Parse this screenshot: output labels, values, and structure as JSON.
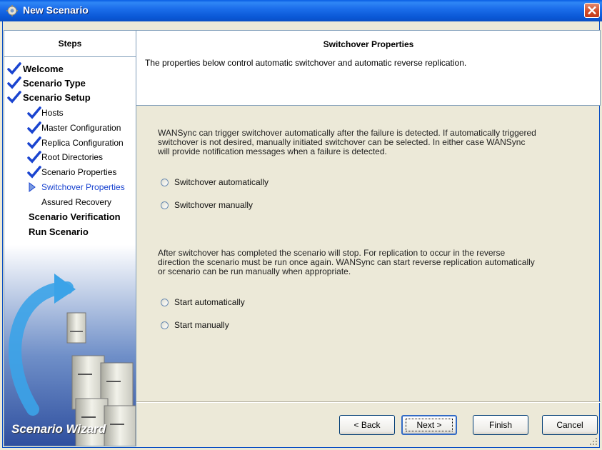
{
  "window": {
    "title": "New Scenario",
    "icon": "scenario-gear-icon",
    "close_icon": "close-icon"
  },
  "steps": {
    "header": "Steps",
    "items": [
      {
        "label": "Welcome",
        "level": 0,
        "state": "done"
      },
      {
        "label": "Scenario Type",
        "level": 0,
        "state": "done"
      },
      {
        "label": "Scenario Setup",
        "level": 0,
        "state": "done"
      },
      {
        "label": "Hosts",
        "level": 1,
        "state": "done"
      },
      {
        "label": "Master Configuration",
        "level": 1,
        "state": "done"
      },
      {
        "label": "Replica Configuration",
        "level": 1,
        "state": "done"
      },
      {
        "label": "Root Directories",
        "level": 1,
        "state": "done"
      },
      {
        "label": "Scenario Properties",
        "level": 1,
        "state": "done"
      },
      {
        "label": "Switchover Properties",
        "level": 1,
        "state": "current"
      },
      {
        "label": "Assured Recovery",
        "level": 1,
        "state": "pending"
      },
      {
        "label": "Scenario Verification",
        "level": 0,
        "state": "pending"
      },
      {
        "label": "Run Scenario",
        "level": 0,
        "state": "pending"
      }
    ],
    "wizard_label": "Scenario Wizard"
  },
  "header": {
    "title": "Switchover Properties",
    "description": "The properties below control automatic switchover and automatic reverse replication."
  },
  "switchover": {
    "text": "WANSync can trigger switchover automatically after the failure is detected. If automatically triggered switchover is not desired, manually initiated switchover can be selected. In either case WANSync will provide notification messages when a failure is detected.",
    "options": [
      "Switchover automatically",
      "Switchover manually"
    ]
  },
  "reverse": {
    "text": "After switchover has completed the scenario will stop. For replication to occur in the reverse direction the scenario must be run once again. WANSync can start reverse replication automatically or scenario can be run manually when appropriate.",
    "options": [
      "Start automatically",
      "Start manually"
    ]
  },
  "buttons": {
    "back": "< Back",
    "next": "Next >",
    "finish": "Finish",
    "cancel": "Cancel"
  },
  "colors": {
    "titlebar": "#0A5FE4",
    "window_bg": "#ECE9D8",
    "check": "#1A44D0",
    "current_step": "#1A44D0",
    "close": "#D14A26"
  }
}
